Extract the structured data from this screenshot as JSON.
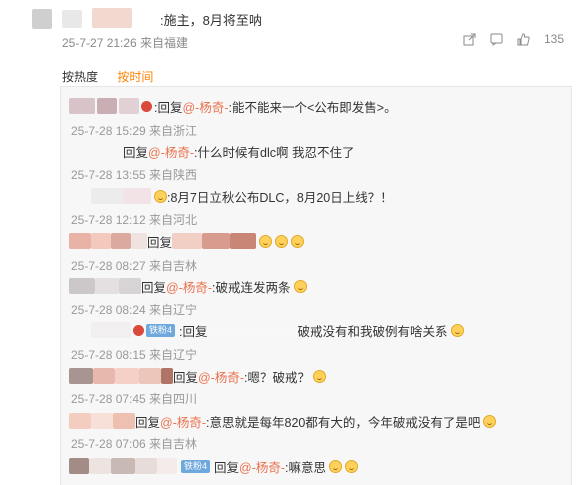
{
  "top_comment": {
    "text": ":施主，8月将至呐",
    "meta": "25-7-27 21:26 来自福建",
    "like_count": "135",
    "icons": [
      "share-icon",
      "comment-icon",
      "like-icon"
    ]
  },
  "sort_tabs": [
    {
      "label": "按热度",
      "active": false
    },
    {
      "label": "按时间",
      "active": true
    }
  ],
  "replies": [
    {
      "prefix": ":回复",
      "mention": "@-杨奇-",
      "text": ":能不能来一个<公布即发售>。",
      "meta": "25-7-28 15:29 来自浙江"
    },
    {
      "prefix": "回复",
      "mention": "@-杨奇-",
      "text": ":什么时候有dlc啊 我忍不住了",
      "meta": "25-7-28 13:55 来自陕西"
    },
    {
      "prefix": "",
      "mention": "",
      "text": ":8月7日立秋公布DLC，8月20日上线？！",
      "meta": "25-7-28 12:12 来自河北"
    },
    {
      "prefix": "回复",
      "mention": "",
      "text": "",
      "meta": "25-7-28 08:27 来自吉林"
    },
    {
      "prefix": "回复",
      "mention": "@-杨奇-",
      "text": ":破戒连发两条",
      "meta": "25-7-28 08:24 来自辽宁"
    },
    {
      "badge": "铁粉4",
      "prefix": ":回复",
      "mention": "",
      "text": "破戒没有和我破例有啥关系",
      "meta": "25-7-28 08:15 来自辽宁"
    },
    {
      "prefix": "回复",
      "mention": "@-杨奇-",
      "text": ":嗯？破戒？",
      "meta": "25-7-28 07:45 来自四川"
    },
    {
      "prefix": "回复",
      "mention": "@-杨奇-",
      "text": ":意思就是每年820都有大的，今年破戒没有了是吧",
      "meta": "25-7-28 07:06 来自吉林"
    },
    {
      "badge": "铁粉4",
      "prefix": "回复",
      "mention": "@-杨奇-",
      "text": ":嘛意思",
      "meta": ""
    }
  ]
}
